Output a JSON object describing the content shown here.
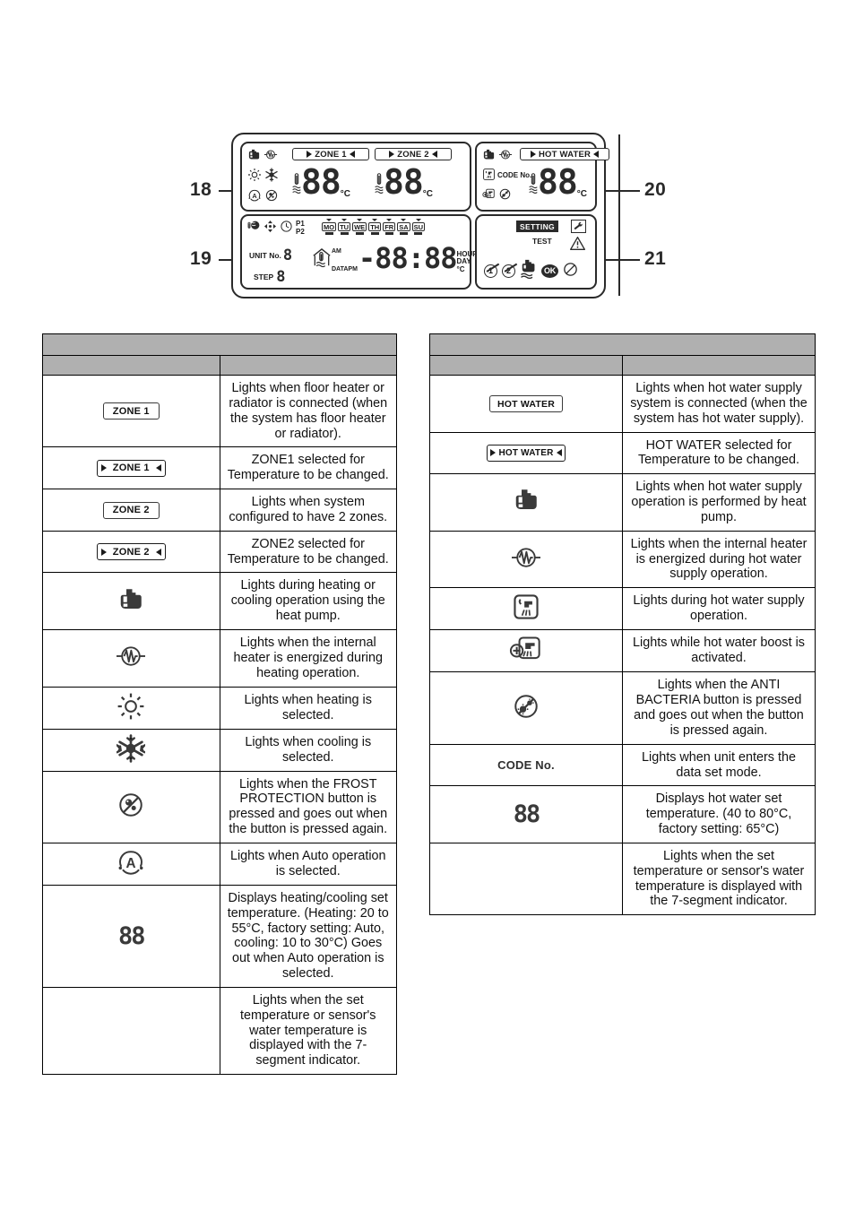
{
  "diagram": {
    "callouts": [
      {
        "num": "18",
        "side": "left"
      },
      {
        "num": "19",
        "side": "left"
      },
      {
        "num": "20",
        "side": "right"
      },
      {
        "num": "21",
        "side": "right"
      }
    ],
    "lcd": {
      "zone1_label": "ZONE 1",
      "zone2_label": "ZONE 2",
      "hotwater_label": "HOT WATER",
      "zone1_value": "88",
      "zone2_value": "88",
      "hotwater_value": "88",
      "celsius": "°C",
      "code_no": "CODE No.",
      "p1": "P1",
      "p2": "P2",
      "days": [
        "MO",
        "TU",
        "WE",
        "TH",
        "FR",
        "SA",
        "SU"
      ],
      "unit_no_label": "UNIT No.",
      "unit_no_value": "8",
      "step_label": "STEP",
      "step_value": "8",
      "data_label": "DATA",
      "am_label": "AM",
      "pm_label": "PM",
      "clock_value": "-88:88",
      "hour_label": "HOUR",
      "day_label": "DAY",
      "clock_celsius": "°C",
      "setting_label": "SETTING",
      "test_label": "TEST",
      "ok_label": "OK",
      "num1": "1",
      "num2": "2"
    }
  },
  "left_table": {
    "header_main": "",
    "header_symbol": "",
    "header_description": "",
    "rows": [
      {
        "symbol_kind": "tag-plain",
        "symbol_text": "ZONE 1",
        "description": "Lights when floor heater or radiator is connected (when the system has floor heater or radiator)."
      },
      {
        "symbol_kind": "tag-selected",
        "symbol_text": "ZONE 1",
        "description": "ZONE1 selected for Temperature to be changed."
      },
      {
        "symbol_kind": "tag-plain",
        "symbol_text": "ZONE 2",
        "description": "Lights when system configured to have 2 zones."
      },
      {
        "symbol_kind": "tag-selected",
        "symbol_text": "ZONE 2",
        "description": "ZONE2 selected for Temperature to be changed."
      },
      {
        "symbol_kind": "icon",
        "symbol_text": "heat-pump-icon",
        "description": "Lights during heating or cooling operation using the heat pump."
      },
      {
        "symbol_kind": "icon",
        "symbol_text": "internal-heater-icon",
        "description": "Lights when the internal heater is energized during heating operation."
      },
      {
        "symbol_kind": "icon",
        "symbol_text": "heating-sun-icon",
        "description": "Lights when heating is selected."
      },
      {
        "symbol_kind": "icon",
        "symbol_text": "cooling-snowflake-icon",
        "description": "Lights when cooling is selected."
      },
      {
        "symbol_kind": "icon",
        "symbol_text": "frost-protection-icon",
        "description": "Lights when the FROST PROTECTION button is pressed and goes out when the button is pressed again."
      },
      {
        "symbol_kind": "icon",
        "symbol_text": "auto-operation-icon",
        "description": "Lights when Auto operation is selected."
      },
      {
        "symbol_kind": "seg88",
        "symbol_text": "88",
        "description": "Displays heating/cooling set temperature. (Heating: 20 to 55°C, factory setting: Auto, cooling: 10 to 30°C) Goes out when Auto operation is selected."
      },
      {
        "symbol_kind": "empty",
        "symbol_text": "",
        "description": "Lights when the set temperature or sensor's water temperature is displayed with the 7-segment indicator."
      }
    ]
  },
  "right_table": {
    "header_main": "",
    "header_symbol": "",
    "header_description": "",
    "rows": [
      {
        "symbol_kind": "tag-plain-hw",
        "symbol_text": "HOT WATER",
        "description": "Lights when hot water supply system is connected (when the system has hot water supply)."
      },
      {
        "symbol_kind": "tag-selected-hw",
        "symbol_text": "HOT WATER",
        "description": "HOT WATER selected for Temperature to be changed."
      },
      {
        "symbol_kind": "icon",
        "symbol_text": "heat-pump-icon",
        "description": "Lights when hot water supply operation is performed by heat pump."
      },
      {
        "symbol_kind": "icon",
        "symbol_text": "internal-heater-icon",
        "description": "Lights when the internal heater is energized during hot water supply operation."
      },
      {
        "symbol_kind": "icon",
        "symbol_text": "hot-water-faucet-icon",
        "description": "Lights during hot water supply operation."
      },
      {
        "symbol_kind": "icon",
        "symbol_text": "hot-water-boost-icon",
        "description": "Lights while hot water boost is activated."
      },
      {
        "symbol_kind": "icon",
        "symbol_text": "anti-bacteria-icon",
        "description": "Lights when the ANTI BACTERIA button is pressed and goes out when the button is pressed again."
      },
      {
        "symbol_kind": "codeno",
        "symbol_text": "CODE No.",
        "description": "Lights when unit enters the data set mode."
      },
      {
        "symbol_kind": "seg88",
        "symbol_text": "88",
        "description": "Displays hot water set temperature. (40 to 80°C, factory setting: 65°C)"
      },
      {
        "symbol_kind": "empty",
        "symbol_text": "",
        "description": "Lights when the set temperature or sensor's water temperature is displayed with the 7-segment indicator."
      }
    ]
  },
  "colors": {
    "header_gray": "#b0b0b0",
    "ink": "#1a1a1a",
    "lcd_border": "#2a2a2a"
  }
}
